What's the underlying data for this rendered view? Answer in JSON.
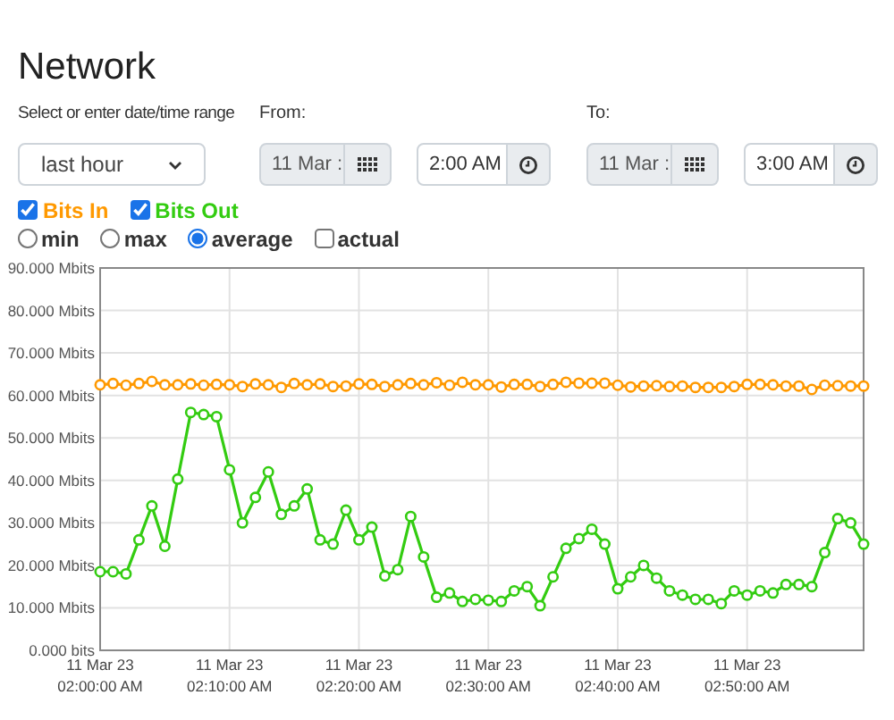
{
  "title": "Network",
  "range": {
    "label": "Select or enter date/time range",
    "value": "last hour"
  },
  "from": {
    "label": "From:",
    "date": "11 Mar :",
    "time": "2:00 AM"
  },
  "to": {
    "label": "To:",
    "date": "11 Mar :",
    "time": "3:00 AM"
  },
  "series_toggles": [
    {
      "checked": true
    },
    {
      "checked": true
    }
  ],
  "modes": [
    {
      "kind": "radio",
      "label": "min",
      "selected": false
    },
    {
      "kind": "radio",
      "label": "max",
      "selected": false
    },
    {
      "kind": "radio",
      "label": "average",
      "selected": true
    },
    {
      "kind": "checkbox",
      "label": "actual",
      "selected": false
    }
  ],
  "chart_data": {
    "type": "line",
    "categories": [
      "11 Mar 23\n02:00:00 AM",
      null,
      null,
      null,
      null,
      null,
      null,
      null,
      null,
      null,
      "11 Mar 23\n02:10:00 AM",
      null,
      null,
      null,
      null,
      null,
      null,
      null,
      null,
      null,
      "11 Mar 23\n02:20:00 AM",
      null,
      null,
      null,
      null,
      null,
      null,
      null,
      null,
      null,
      "11 Mar 23\n02:30:00 AM",
      null,
      null,
      null,
      null,
      null,
      null,
      null,
      null,
      null,
      "11 Mar 23\n02:40:00 AM",
      null,
      null,
      null,
      null,
      null,
      null,
      null,
      null,
      null,
      "11 Mar 23\n02:50:00 AM",
      null,
      null,
      null,
      null,
      null,
      null,
      null,
      null,
      null
    ],
    "grid": true,
    "series": [
      {
        "name": "Bits In",
        "color": "#ff9900",
        "marker": "circle",
        "values": [
          62.5,
          62.8,
          62.4,
          62.8,
          63.3,
          62.5,
          62.5,
          62.7,
          62.4,
          62.6,
          62.5,
          62.1,
          62.7,
          62.5,
          61.9,
          62.8,
          62.5,
          62.7,
          62.1,
          62.2,
          62.7,
          62.6,
          62.1,
          62.5,
          62.8,
          62.5,
          63.0,
          62.4,
          63.1,
          62.5,
          62.5,
          62.0,
          62.6,
          62.6,
          62.1,
          62.6,
          63.1,
          62.9,
          62.9,
          62.9,
          62.4,
          62.0,
          62.2,
          62.3,
          62.1,
          62.2,
          61.9,
          61.9,
          61.9,
          62.1,
          62.6,
          62.6,
          62.5,
          62.2,
          62.2,
          61.4,
          62.4,
          62.3,
          62.2,
          62.2
        ]
      },
      {
        "name": "Bits Out",
        "color": "#33cc11",
        "marker": "circle",
        "values": [
          18.5,
          18.5,
          18,
          26,
          34,
          24.5,
          40.3,
          56,
          55.5,
          55,
          42.5,
          30,
          36,
          42,
          32,
          34,
          38,
          26,
          25,
          33,
          26,
          29,
          17.5,
          19,
          31.5,
          22,
          12.5,
          13.5,
          11.5,
          12,
          11.8,
          11.5,
          14,
          15,
          10.5,
          17.3,
          24,
          26.3,
          28.5,
          25,
          14.5,
          17.3,
          20,
          17,
          14,
          13,
          12,
          12,
          11,
          14,
          13,
          14,
          13.5,
          15.5,
          15.5,
          15,
          23,
          31,
          30,
          25
        ]
      }
    ],
    "ylim": [
      0,
      90
    ],
    "yticks": [
      {
        "value": 0,
        "label": "0.000 bits"
      },
      {
        "value": 10,
        "label": "10.000 Mbits"
      },
      {
        "value": 20,
        "label": "20.000 Mbits"
      },
      {
        "value": 30,
        "label": "30.000 Mbits"
      },
      {
        "value": 40,
        "label": "40.000 Mbits"
      },
      {
        "value": 50,
        "label": "50.000 Mbits"
      },
      {
        "value": 60,
        "label": "60.000 Mbits"
      },
      {
        "value": 70,
        "label": "70.000 Mbits"
      },
      {
        "value": 80,
        "label": "80.000 Mbits"
      },
      {
        "value": 90,
        "label": "90.000 Mbits"
      }
    ]
  }
}
